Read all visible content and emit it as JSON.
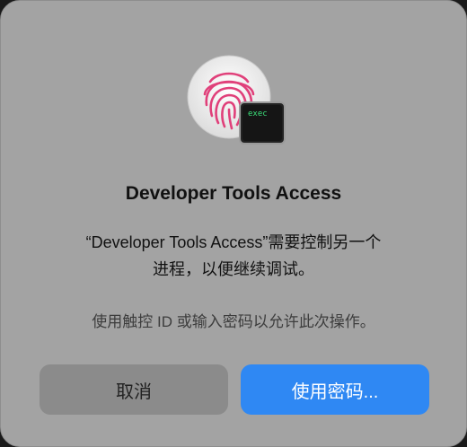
{
  "dialog": {
    "title": "Developer Tools Access",
    "message_line1": "“Developer Tools Access”需要控制另一个",
    "message_line2": "进程，以便继续调试。",
    "subtitle": "使用触控 ID 或输入密码以允许此次操作。"
  },
  "icon": {
    "name": "touch-id-fingerprint-icon",
    "terminal_text": "exec",
    "accent_color": "#e0407a",
    "terminal_text_color": "#3be07a"
  },
  "buttons": {
    "cancel_label": "取消",
    "primary_label": "使用密码...",
    "primary_color": "#2f88f3"
  }
}
